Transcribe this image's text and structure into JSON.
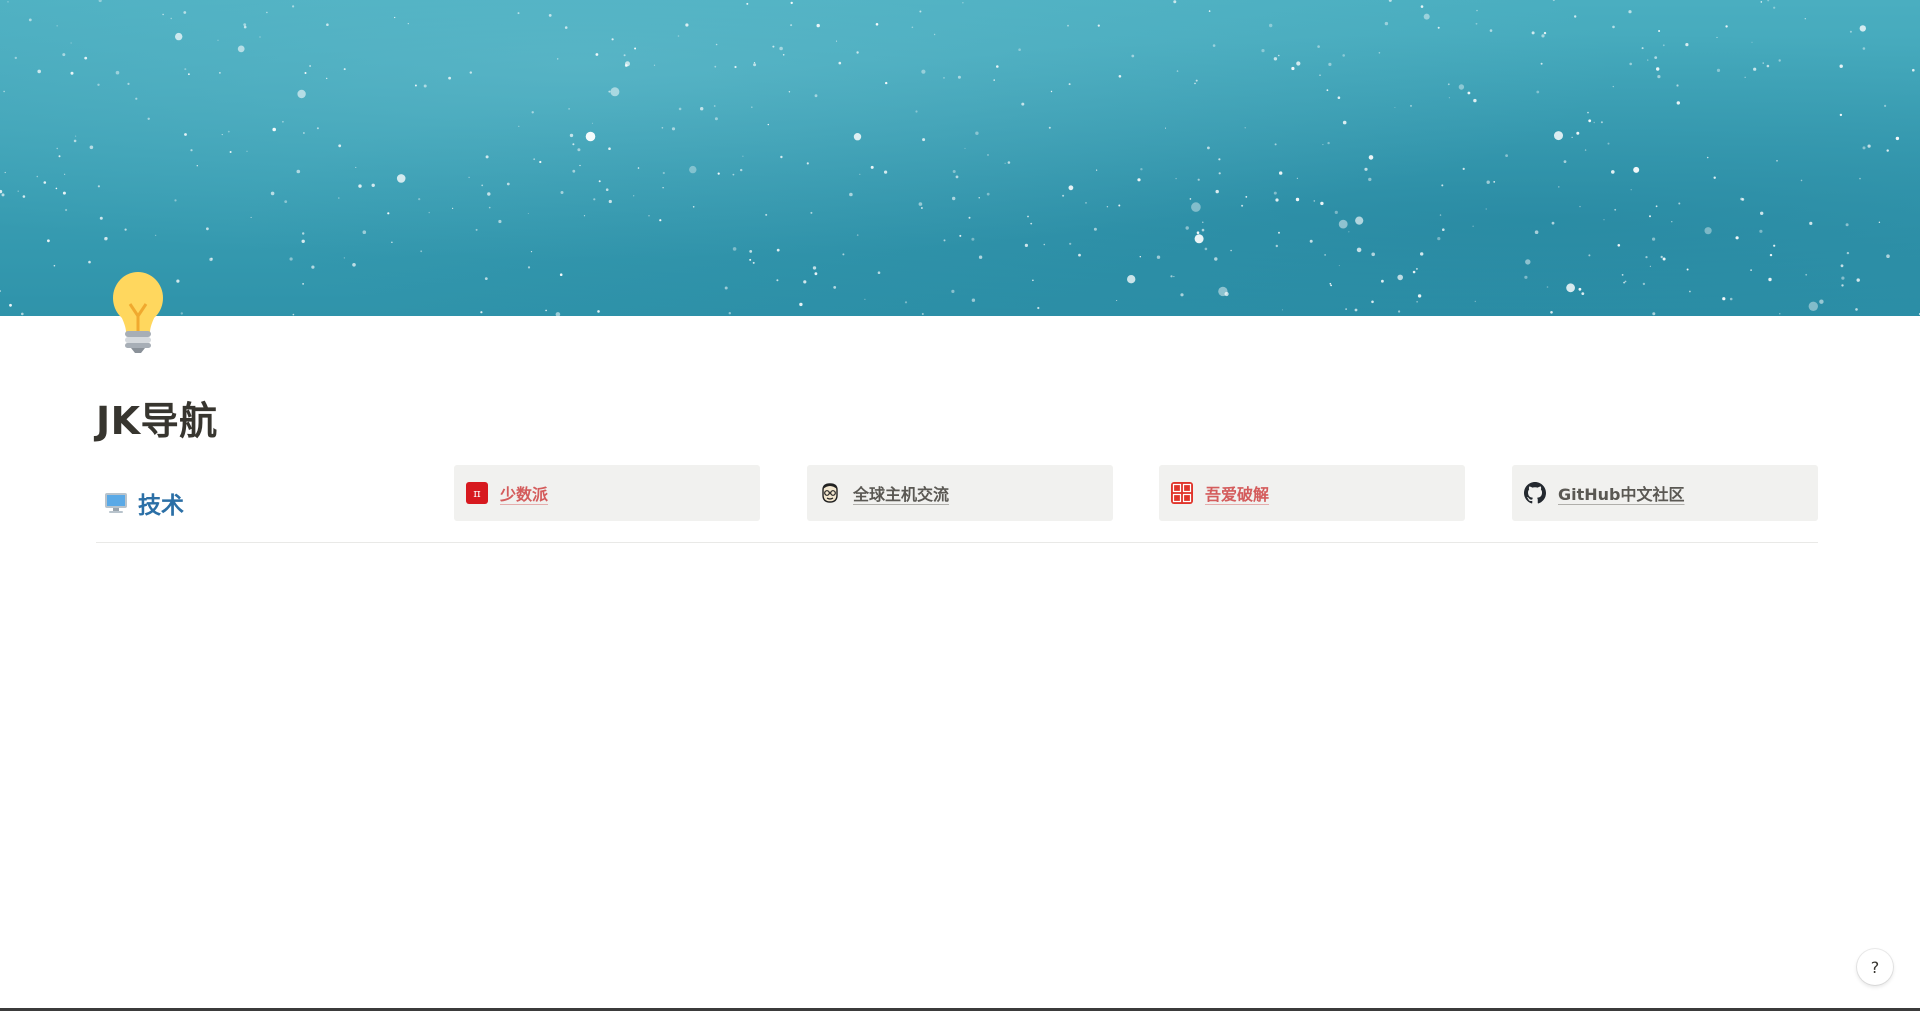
{
  "page": {
    "title": "JK导航",
    "cover_colors": [
      "#4aaec0",
      "#2f93aa"
    ],
    "icon": "light-bulb-icon"
  },
  "section": {
    "icon": "desktop-computer-icon",
    "label": "技术",
    "label_color": "#2b6fa6",
    "links": [
      {
        "label": "少数派",
        "icon": "sspai-logo-icon",
        "color": "#d45c5c"
      },
      {
        "label": "全球主机交流",
        "icon": "hostloc-avatar-icon",
        "color": "#5a5853"
      },
      {
        "label": "吾爱破解",
        "icon": "52pojie-logo-icon",
        "color": "#d45c5c"
      },
      {
        "label": "GitHub中文社区",
        "icon": "github-icon",
        "color": "#5a5853"
      }
    ]
  },
  "help": {
    "label": "?"
  }
}
